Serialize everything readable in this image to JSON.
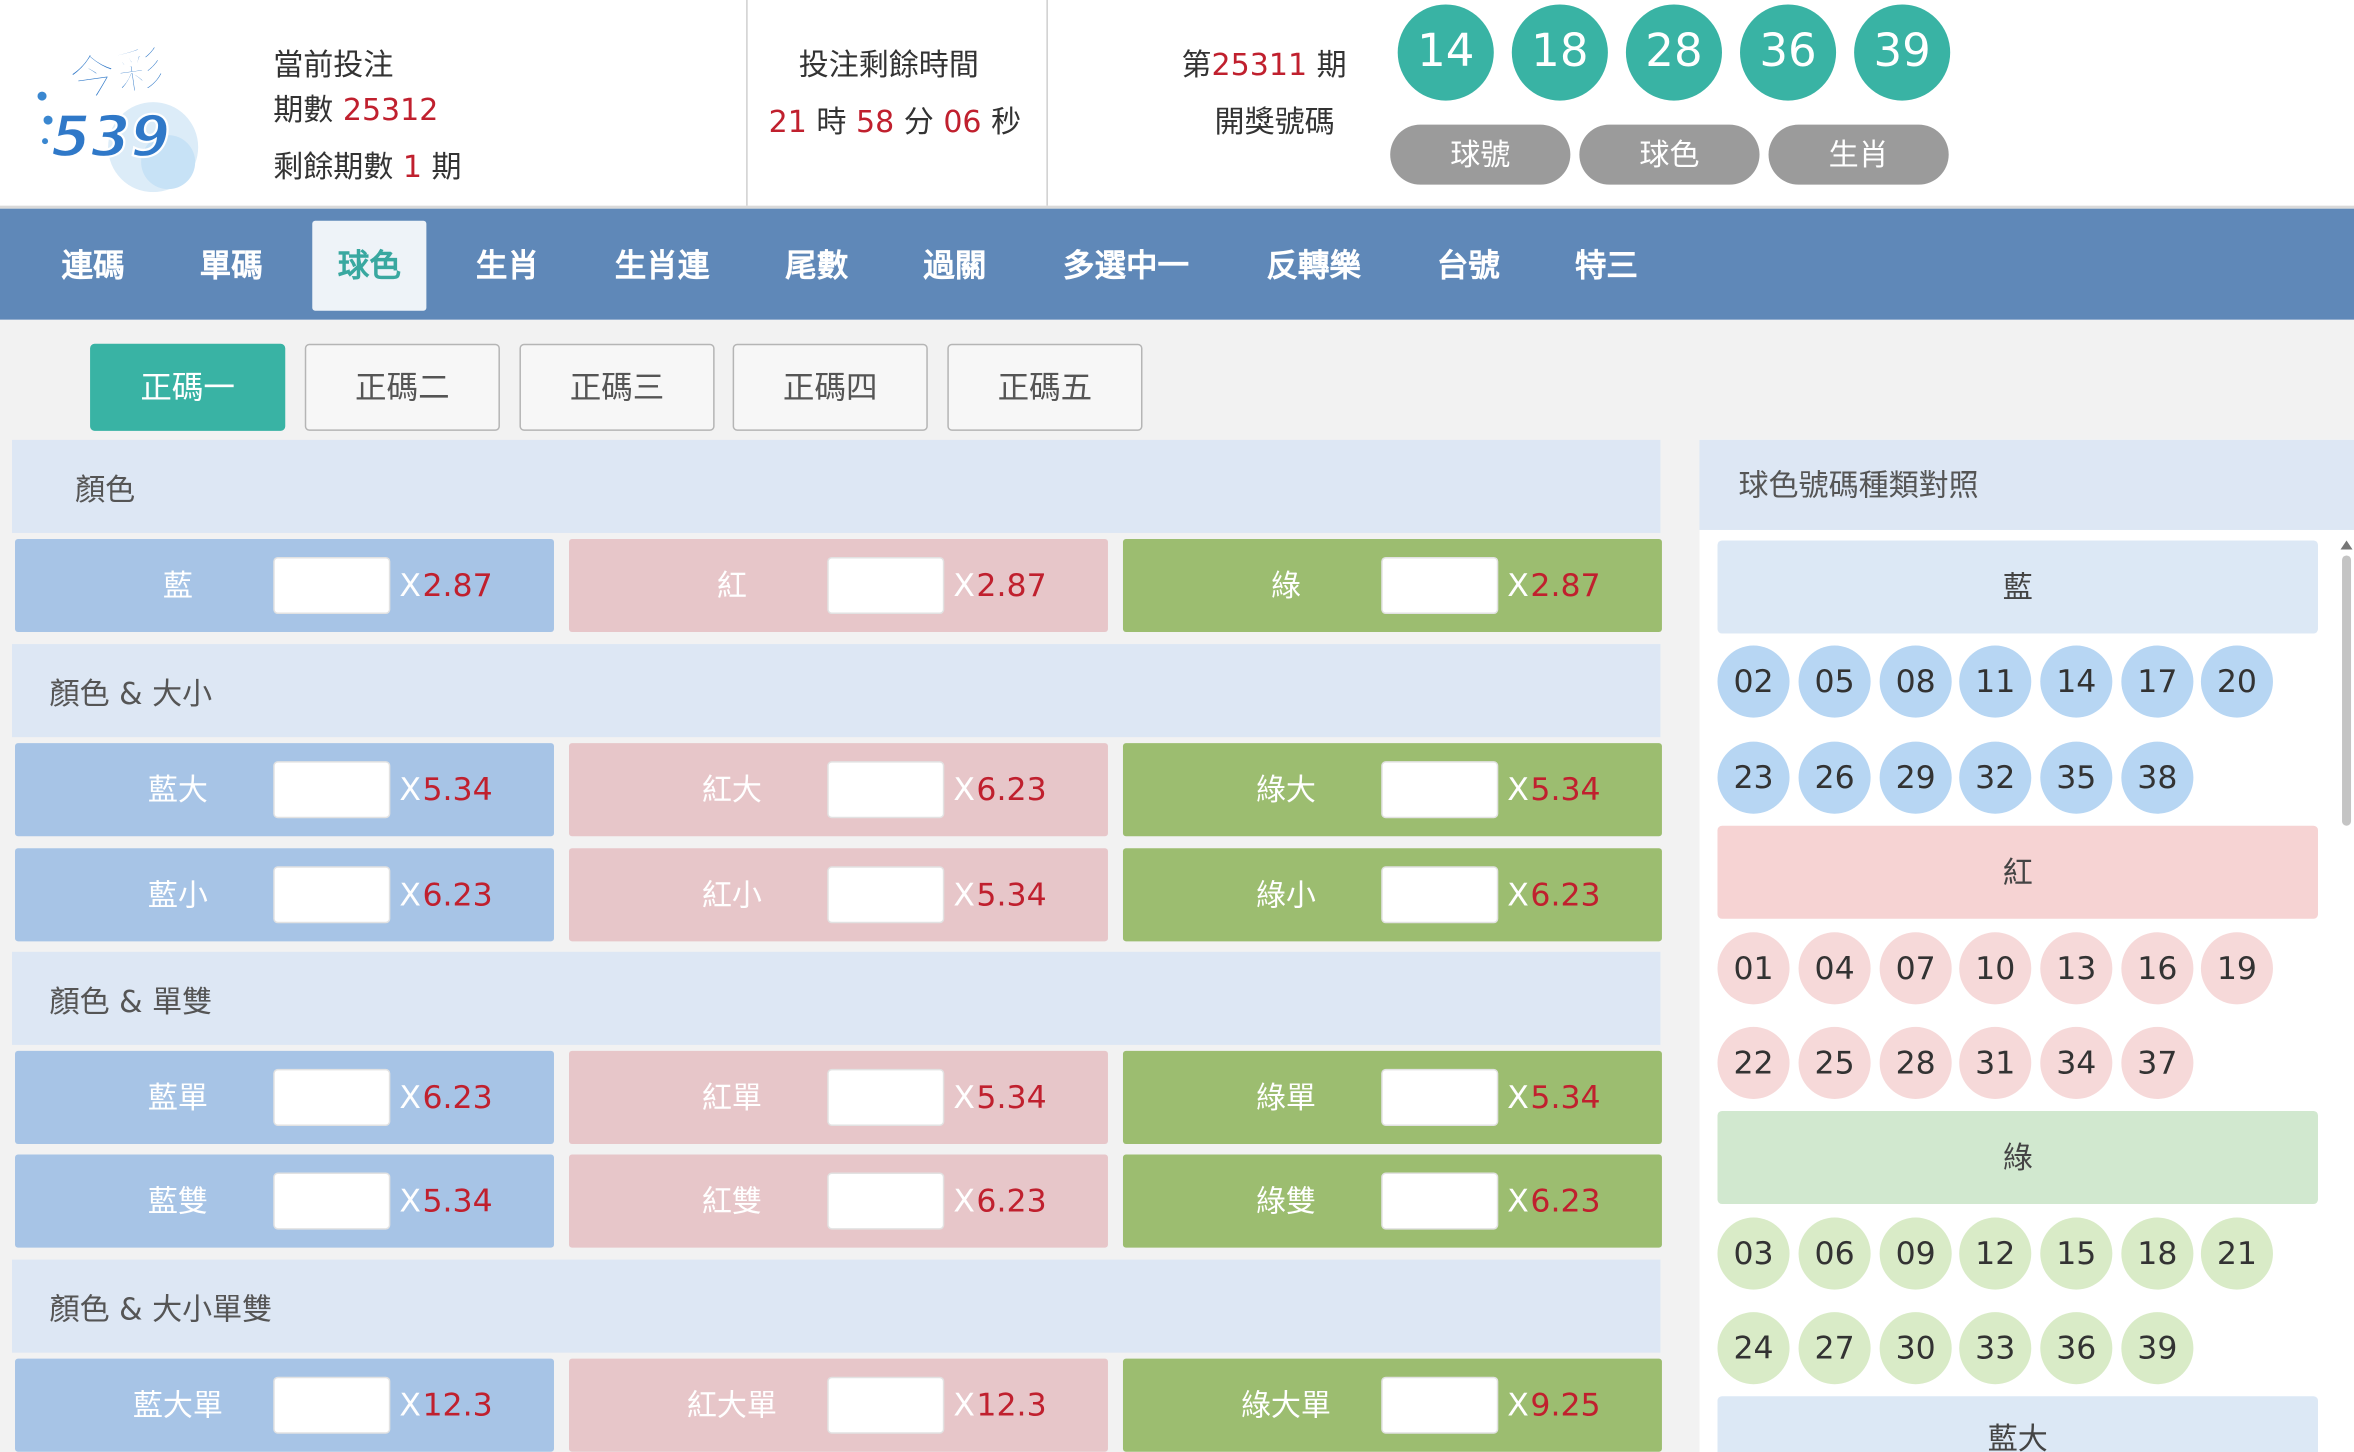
{
  "header": {
    "logo_text_top": "今彩",
    "logo_text_num": "539",
    "current_label": "當前投注",
    "period_label": "期數",
    "period_value": "25312",
    "remaining_label": "剩餘期數",
    "remaining_value": "1",
    "remaining_unit": "期",
    "countdown_label": "投注剩餘時間",
    "countdown": {
      "h": "21",
      "h_unit": "時",
      "m": "58",
      "m_unit": "分",
      "s": "06",
      "s_unit": "秒"
    },
    "draw_prefix": "第",
    "draw_period": "25311",
    "draw_suffix": "期",
    "draw_label": "開獎號碼",
    "draw_numbers": [
      "14",
      "18",
      "28",
      "36",
      "39"
    ],
    "view_buttons": [
      "球號",
      "球色",
      "生肖"
    ],
    "ball_color": "#39b3a4"
  },
  "nav": {
    "items": [
      "連碼",
      "單碼",
      "球色",
      "生肖",
      "生肖連",
      "尾數",
      "過關",
      "多選中一",
      "反轉樂",
      "台號",
      "特三"
    ],
    "active": "球色"
  },
  "subtabs": {
    "items": [
      "正碼一",
      "正碼二",
      "正碼三",
      "正碼四",
      "正碼五"
    ],
    "active": "正碼一"
  },
  "odds_prefix": "X",
  "sections": [
    {
      "title": "顏色",
      "rows": [
        [
          {
            "label": "藍",
            "odds": "2.87"
          },
          {
            "label": "紅",
            "odds": "2.87"
          },
          {
            "label": "綠",
            "odds": "2.87"
          }
        ]
      ]
    },
    {
      "title": "顏色 & 大小",
      "rows": [
        [
          {
            "label": "藍大",
            "odds": "5.34"
          },
          {
            "label": "紅大",
            "odds": "6.23"
          },
          {
            "label": "綠大",
            "odds": "5.34"
          }
        ],
        [
          {
            "label": "藍小",
            "odds": "6.23"
          },
          {
            "label": "紅小",
            "odds": "5.34"
          },
          {
            "label": "綠小",
            "odds": "6.23"
          }
        ]
      ]
    },
    {
      "title": "顏色 & 單雙",
      "rows": [
        [
          {
            "label": "藍單",
            "odds": "6.23"
          },
          {
            "label": "紅單",
            "odds": "5.34"
          },
          {
            "label": "綠單",
            "odds": "5.34"
          }
        ],
        [
          {
            "label": "藍雙",
            "odds": "5.34"
          },
          {
            "label": "紅雙",
            "odds": "6.23"
          },
          {
            "label": "綠雙",
            "odds": "6.23"
          }
        ]
      ]
    },
    {
      "title": "顏色 & 大小單雙",
      "rows": [
        [
          {
            "label": "藍大單",
            "odds": "12.3"
          },
          {
            "label": "紅大單",
            "odds": "12.3"
          },
          {
            "label": "綠大單",
            "odds": "9.25"
          }
        ]
      ]
    }
  ],
  "colors": {
    "blue": "#a7c4e6",
    "red": "#e7c6c9",
    "green": "#9cbd70",
    "accent": "#39b3a4",
    "nav": "#5f88b8",
    "odds": "#c0202e"
  },
  "reference": {
    "title": "球色號碼種類對照",
    "groups": [
      {
        "name": "藍",
        "numbers": [
          "02",
          "05",
          "08",
          "11",
          "14",
          "17",
          "20",
          "23",
          "26",
          "29",
          "32",
          "35",
          "38"
        ]
      },
      {
        "name": "紅",
        "numbers": [
          "01",
          "04",
          "07",
          "10",
          "13",
          "16",
          "19",
          "22",
          "25",
          "28",
          "31",
          "34",
          "37"
        ]
      },
      {
        "name": "綠",
        "numbers": [
          "03",
          "06",
          "09",
          "12",
          "15",
          "18",
          "21",
          "24",
          "27",
          "30",
          "33",
          "36",
          "39"
        ]
      },
      {
        "name": "藍大",
        "numbers": []
      }
    ]
  }
}
